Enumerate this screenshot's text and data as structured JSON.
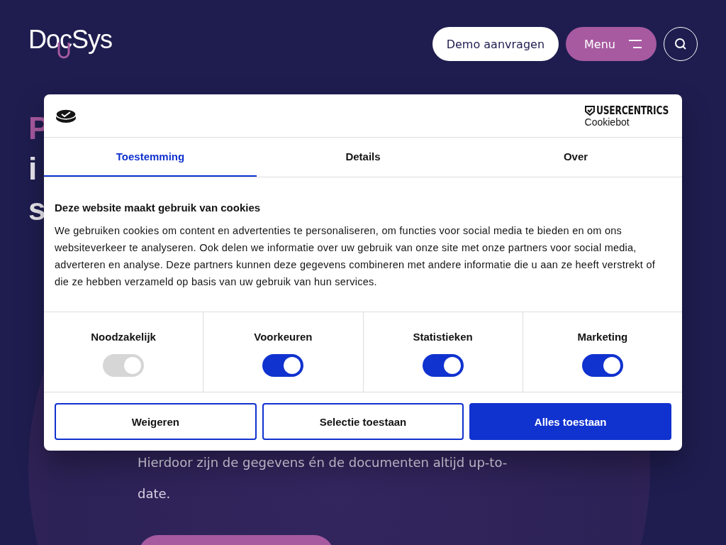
{
  "header": {
    "logo": "DocSys",
    "demo_button": "Demo aanvragen",
    "menu_button": "Menu"
  },
  "hero": {
    "heading_lines": [
      {
        "text": "P",
        "accent": true
      },
      {
        "text": "i",
        "accent": false
      },
      {
        "text": "s",
        "accent": false
      }
    ],
    "paragraph": "Hierdoor zijn de gegevens én de documenten altijd up-to-date."
  },
  "cookie_dialog": {
    "brand": "USERCENTRICS",
    "brand_sub": "Cookiebot",
    "tabs": [
      {
        "label": "Toestemming",
        "selected": true
      },
      {
        "label": "Details",
        "selected": false
      },
      {
        "label": "Over",
        "selected": false
      }
    ],
    "title": "Deze website maakt gebruik van cookies",
    "body": "We gebruiken cookies om content en advertenties te personaliseren, om functies voor social media te bieden en om ons websiteverkeer te analyseren. Ook delen we informatie over uw gebruik van onze site met onze partners voor social media, adverteren en analyse. Deze partners kunnen deze gegevens combineren met andere informatie die u aan ze heeft verstrekt of die ze hebben verzameld op basis van uw gebruik van hun services.",
    "categories": [
      {
        "label": "Noodzakelijk",
        "checked": true,
        "disabled": true
      },
      {
        "label": "Voorkeuren",
        "checked": true,
        "disabled": false
      },
      {
        "label": "Statistieken",
        "checked": true,
        "disabled": false
      },
      {
        "label": "Marketing",
        "checked": true,
        "disabled": false
      }
    ],
    "buttons": [
      {
        "label": "Weigeren",
        "kind": "outline"
      },
      {
        "label": "Selectie toestaan",
        "kind": "outline"
      },
      {
        "label": "Alles toestaan",
        "kind": "primary"
      }
    ]
  }
}
